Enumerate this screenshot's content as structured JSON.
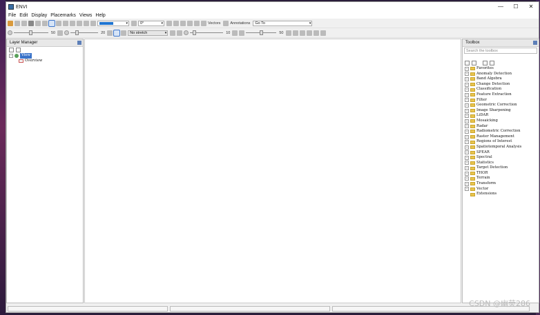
{
  "window": {
    "title": "ENVI",
    "minimize": "—",
    "maximize": "☐",
    "close": "✕"
  },
  "menu": [
    "File",
    "Edit",
    "Display",
    "Placemarks",
    "Views",
    "Help"
  ],
  "toolbar1": {
    "rotation_value": "0°",
    "vectors_label": "Vectors",
    "annotations_label": "Annotations",
    "goto_label": "Go To"
  },
  "toolbar2": {
    "brightness_value": "50",
    "contrast_value": "20",
    "stretch_value": "No stretch",
    "sharpen_value": "10",
    "transparency_value": "50"
  },
  "layer_manager": {
    "title": "Layer Manager",
    "root": "View",
    "child": "Overview"
  },
  "toolbox": {
    "title": "Toolbox",
    "search_placeholder": "Search the toolbox",
    "items": [
      "Favorites",
      "Anomaly Detection",
      "Band Algebra",
      "Change Detection",
      "Classification",
      "Feature Extraction",
      "Filter",
      "Geometric Correction",
      "Image Sharpening",
      "LiDAR",
      "Mosaicking",
      "Radar",
      "Radiometric Correction",
      "Raster Management",
      "Regions of Interest",
      "Spatiotemporal Analysis",
      "SPEAR",
      "Spectral",
      "Statistics",
      "Target Detection",
      "THOR",
      "Terrain",
      "Transform",
      "Vector",
      "Extensions"
    ]
  },
  "watermark": "CSDN @幽荧286",
  "colors": {
    "selection": "#3a73c9",
    "folder": "#e8c44f",
    "accent_blue": "#1e74d1"
  }
}
